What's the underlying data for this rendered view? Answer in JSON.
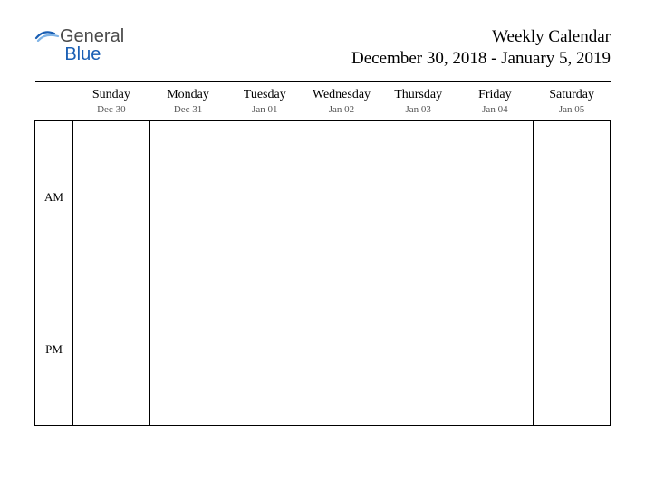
{
  "logo": {
    "part1": "General",
    "part2": "Blue"
  },
  "title": "Weekly Calendar",
  "date_range": "December 30, 2018 - January 5, 2019",
  "days": [
    {
      "name": "Sunday",
      "date": "Dec 30"
    },
    {
      "name": "Monday",
      "date": "Dec 31"
    },
    {
      "name": "Tuesday",
      "date": "Jan 01"
    },
    {
      "name": "Wednesday",
      "date": "Jan 02"
    },
    {
      "name": "Thursday",
      "date": "Jan 03"
    },
    {
      "name": "Friday",
      "date": "Jan 04"
    },
    {
      "name": "Saturday",
      "date": "Jan 05"
    }
  ],
  "periods": [
    "AM",
    "PM"
  ]
}
